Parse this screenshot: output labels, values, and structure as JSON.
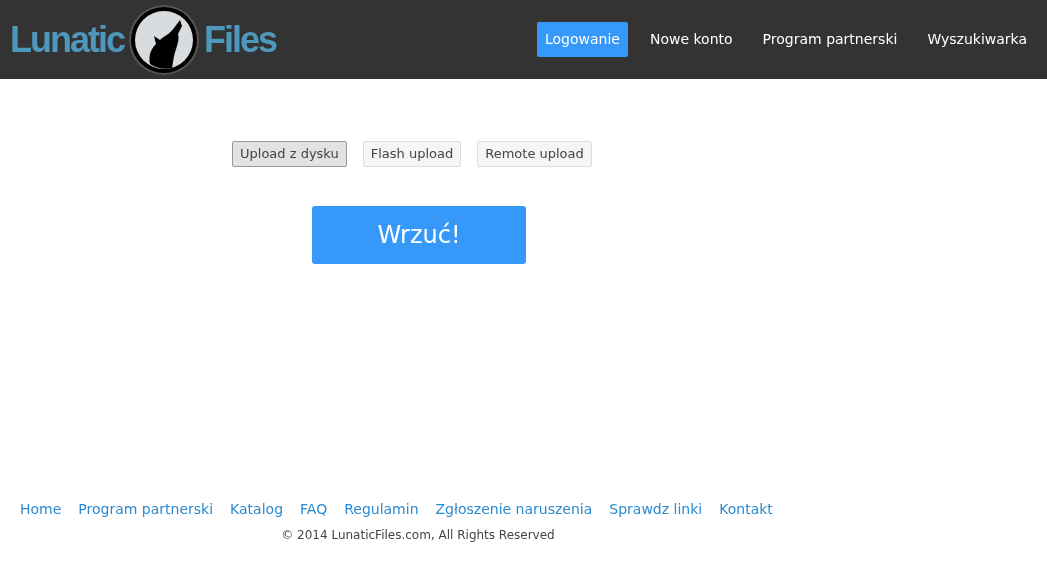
{
  "logo": {
    "left": "Lunatic",
    "right": "Files"
  },
  "nav": [
    {
      "label": "Logowanie",
      "selected": true
    },
    {
      "label": "Nowe konto",
      "selected": false
    },
    {
      "label": "Program partnerski",
      "selected": false
    },
    {
      "label": "Wyszukiwarka",
      "selected": false
    }
  ],
  "upload_tabs": [
    {
      "label": "Upload z dysku",
      "selected": true
    },
    {
      "label": "Flash upload",
      "selected": false
    },
    {
      "label": "Remote upload",
      "selected": false
    }
  ],
  "submit_button": "Wrzuć!",
  "footer_links": [
    "Home",
    "Program partnerski",
    "Katalog",
    "FAQ",
    "Regulamin",
    "Zgłoszenie naruszenia",
    "Sprawdz linki",
    "Kontakt"
  ],
  "copyright": "© 2014 LunaticFiles.com, All Rights Reserved"
}
